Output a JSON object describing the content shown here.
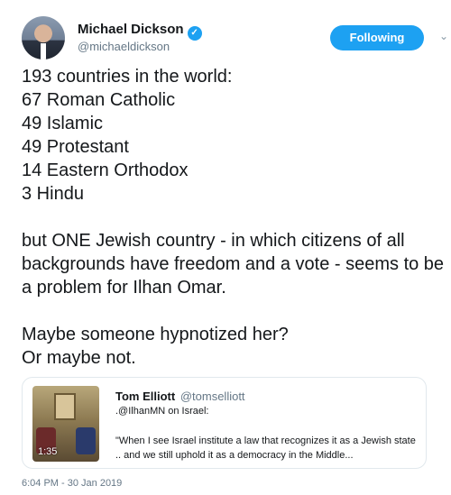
{
  "author": {
    "name": "Michael Dickson",
    "handle": "@michaeldickson",
    "verified_icon": "✓"
  },
  "follow_button": {
    "label": "Following"
  },
  "menu_caret": "⌄",
  "tweet": {
    "text": "193 countries in the world:\n67 Roman Catholic\n49 Islamic\n49 Protestant\n14 Eastern Orthodox\n3 Hindu\n\nbut ONE Jewish country - in which citizens of all backgrounds have freedom and a vote - seems to be a problem for Ilhan Omar.\n\nMaybe someone hypnotized her?\nOr maybe not."
  },
  "quoted_tweet": {
    "author_name": "Tom Elliott",
    "author_handle": "@tomselliott",
    "line1": ".@IlhanMN on Israel:",
    "line2": "\"When I see Israel institute a law that recognizes it as a Jewish state ..  and we still uphold it as a democracy in the Middle...",
    "video_duration": "1:35"
  },
  "timestamp": "6:04 PM - 30 Jan 2019",
  "colors": {
    "accent": "#1da1f2",
    "text": "#14171a",
    "muted": "#657786",
    "border": "#e1e8ed"
  }
}
